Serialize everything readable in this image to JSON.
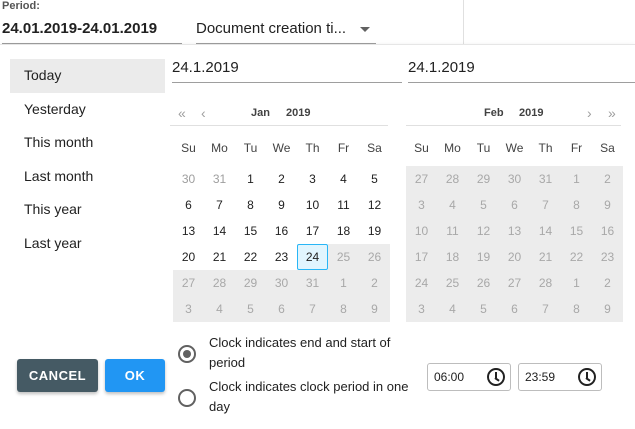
{
  "period": {
    "label": "Period:",
    "range": "24.01.2019-24.01.2019"
  },
  "type_select": {
    "value": "Document creation ti..."
  },
  "presets": [
    "Today",
    "Yesterday",
    "This month",
    "Last month",
    "This year",
    "Last year"
  ],
  "inputs": {
    "start": "24.1.2019",
    "end": "24.1.2019"
  },
  "nav": {
    "first": "«",
    "prev": "‹",
    "next": "›",
    "last": "»"
  },
  "calendars": [
    {
      "month": "Jan",
      "year": "2019",
      "weekdays": [
        "Su",
        "Mo",
        "Tu",
        "We",
        "Th",
        "Fr",
        "Sa"
      ],
      "weeks": [
        [
          [
            "30",
            "other"
          ],
          [
            "31",
            "other"
          ],
          [
            "1",
            "cur"
          ],
          [
            "2",
            "cur"
          ],
          [
            "3",
            "cur"
          ],
          [
            "4",
            "cur"
          ],
          [
            "5",
            "cur"
          ]
        ],
        [
          [
            "6",
            "cur"
          ],
          [
            "7",
            "cur"
          ],
          [
            "8",
            "cur"
          ],
          [
            "9",
            "cur"
          ],
          [
            "10",
            "cur"
          ],
          [
            "11",
            "cur"
          ],
          [
            "12",
            "cur"
          ]
        ],
        [
          [
            "13",
            "cur"
          ],
          [
            "14",
            "cur"
          ],
          [
            "15",
            "cur"
          ],
          [
            "16",
            "cur"
          ],
          [
            "17",
            "cur"
          ],
          [
            "18",
            "cur"
          ],
          [
            "19",
            "cur"
          ]
        ],
        [
          [
            "20",
            "cur"
          ],
          [
            "21",
            "cur"
          ],
          [
            "22",
            "cur"
          ],
          [
            "23",
            "cur"
          ],
          [
            "24",
            "sel"
          ],
          [
            "25",
            "dis"
          ],
          [
            "26",
            "dis"
          ]
        ],
        [
          [
            "27",
            "dis"
          ],
          [
            "28",
            "dis"
          ],
          [
            "29",
            "dis"
          ],
          [
            "30",
            "dis"
          ],
          [
            "31",
            "dis"
          ],
          [
            "1",
            "dis"
          ],
          [
            "2",
            "dis"
          ]
        ],
        [
          [
            "3",
            "dis"
          ],
          [
            "4",
            "dis"
          ],
          [
            "5",
            "dis"
          ],
          [
            "6",
            "dis"
          ],
          [
            "7",
            "dis"
          ],
          [
            "8",
            "dis"
          ],
          [
            "9",
            "dis"
          ]
        ]
      ]
    },
    {
      "month": "Feb",
      "year": "2019",
      "weekdays": [
        "Su",
        "Mo",
        "Tu",
        "We",
        "Th",
        "Fr",
        "Sa"
      ],
      "weeks": [
        [
          [
            "27",
            "dis"
          ],
          [
            "28",
            "dis"
          ],
          [
            "29",
            "dis"
          ],
          [
            "30",
            "dis"
          ],
          [
            "31",
            "dis"
          ],
          [
            "1",
            "dis"
          ],
          [
            "2",
            "dis"
          ]
        ],
        [
          [
            "3",
            "dis"
          ],
          [
            "4",
            "dis"
          ],
          [
            "5",
            "dis"
          ],
          [
            "6",
            "dis"
          ],
          [
            "7",
            "dis"
          ],
          [
            "8",
            "dis"
          ],
          [
            "9",
            "dis"
          ]
        ],
        [
          [
            "10",
            "dis"
          ],
          [
            "11",
            "dis"
          ],
          [
            "12",
            "dis"
          ],
          [
            "13",
            "dis"
          ],
          [
            "14",
            "dis"
          ],
          [
            "15",
            "dis"
          ],
          [
            "16",
            "dis"
          ]
        ],
        [
          [
            "17",
            "dis"
          ],
          [
            "18",
            "dis"
          ],
          [
            "19",
            "dis"
          ],
          [
            "20",
            "dis"
          ],
          [
            "21",
            "dis"
          ],
          [
            "22",
            "dis"
          ],
          [
            "23",
            "dis"
          ]
        ],
        [
          [
            "24",
            "dis"
          ],
          [
            "25",
            "dis"
          ],
          [
            "26",
            "dis"
          ],
          [
            "27",
            "dis"
          ],
          [
            "28",
            "dis"
          ],
          [
            "1",
            "dis"
          ],
          [
            "2",
            "dis"
          ]
        ],
        [
          [
            "3",
            "dis"
          ],
          [
            "4",
            "dis"
          ],
          [
            "5",
            "dis"
          ],
          [
            "6",
            "dis"
          ],
          [
            "7",
            "dis"
          ],
          [
            "8",
            "dis"
          ],
          [
            "9",
            "dis"
          ]
        ]
      ]
    }
  ],
  "options": {
    "end_start": "Clock indicates end and start of period",
    "clock_period": "Clock indicates clock period in one day"
  },
  "times": {
    "start": "06:00",
    "end": "23:59"
  },
  "buttons": {
    "cancel": "CANCEL",
    "ok": "OK"
  },
  "colors": {
    "ok": "#2196f3",
    "cancel": "#455a64",
    "selected_border": "#29b6f6"
  }
}
